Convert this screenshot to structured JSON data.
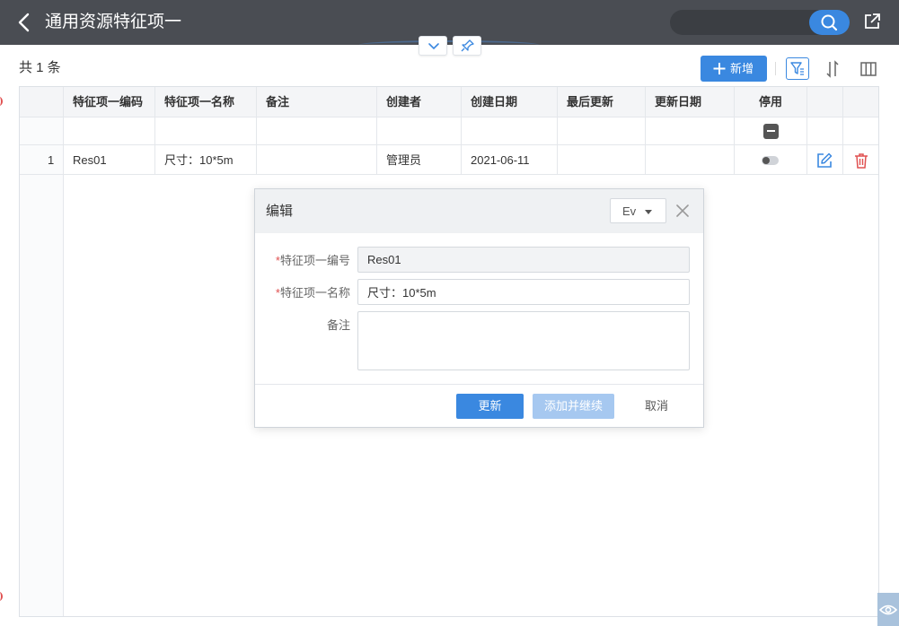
{
  "header": {
    "title": "通用资源特征项一",
    "search_placeholder": ""
  },
  "toolbar": {
    "record_count": "共 1 条",
    "add_label": "新增"
  },
  "grid": {
    "columns": [
      "特征项一编码",
      "特征项一名称",
      "备注",
      "创建者",
      "创建日期",
      "最后更新",
      "更新日期",
      "停用"
    ],
    "rows": [
      {
        "index": "1",
        "code": "Res01",
        "name": "尺寸：10*5m",
        "remark": "",
        "creator": "管理员",
        "created_date": "2021-06-11",
        "last_updated_by": "",
        "updated_date": "",
        "disabled": false
      }
    ]
  },
  "dialog": {
    "title": "编辑",
    "language": "Ev",
    "fields": {
      "code_label": "特征项一编号",
      "code_value": "Res01",
      "name_label": "特征项一名称",
      "name_value": "尺寸：10*5m",
      "remark_label": "备注",
      "remark_value": "",
      "required_mark": "*"
    },
    "buttons": {
      "update": "更新",
      "add_continue": "添加并继续",
      "cancel": "取消"
    }
  },
  "colors": {
    "header_bg": "#4a4d53",
    "accent": "#3a88e0",
    "accent_disabled": "#a6c8f0",
    "danger": "#e05050"
  }
}
